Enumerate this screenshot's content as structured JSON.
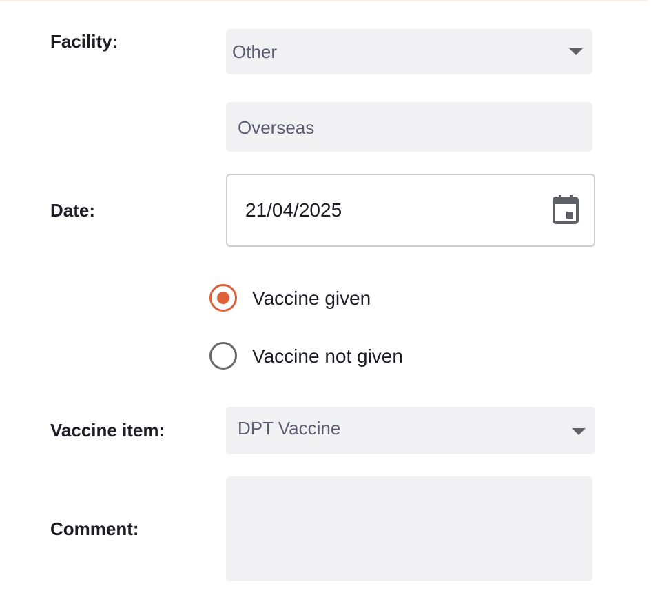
{
  "facility": {
    "label": "Facility:",
    "selected": "Other",
    "other_value": "Overseas"
  },
  "date": {
    "label": "Date:",
    "value": "21/04/2025",
    "icon": "calendar-icon"
  },
  "vaccine_status": {
    "options": [
      {
        "label": "Vaccine given",
        "checked": true
      },
      {
        "label": "Vaccine not given",
        "checked": false
      }
    ]
  },
  "vaccine_item": {
    "label": "Vaccine item:",
    "selected": "DPT Vaccine"
  },
  "comment": {
    "label": "Comment:",
    "value": ""
  },
  "colors": {
    "accent": "#e0603c",
    "field_bg": "#f1f1f4",
    "text": "#1c1c24",
    "muted_text": "#5d5d72"
  }
}
